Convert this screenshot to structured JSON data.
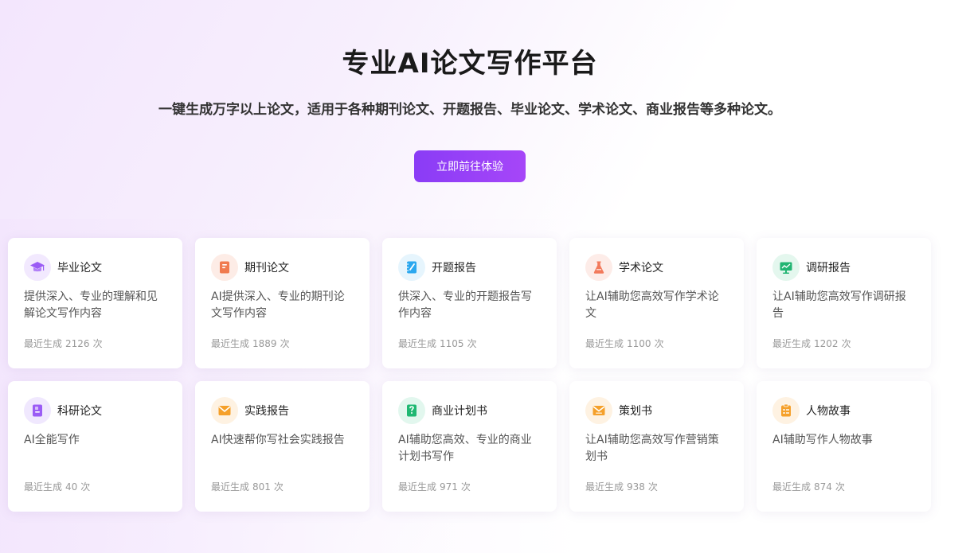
{
  "hero": {
    "title": "专业AI论文写作平台",
    "subtitle": "一键生成万字以上论文，适用于各种期刊论文、开题报告、毕业论文、学术论文、商业报告等多种论文。",
    "cta_label": "立即前往体验"
  },
  "stats_prefix": "最近生成",
  "stats_suffix": "次",
  "colors": {
    "accent": "#9340f7"
  },
  "cards": [
    {
      "title": "毕业论文",
      "desc": "提供深入、专业的理解和见解论文写作内容",
      "count": "2126",
      "icon": "graduation-cap-icon",
      "icon_bg": "#f2e9fe",
      "icon_color": "#9b5cf5"
    },
    {
      "title": "期刊论文",
      "desc": "AI提供深入、专业的期刊论文写作内容",
      "count": "1889",
      "icon": "journal-icon",
      "icon_bg": "#fdece6",
      "icon_color": "#f07b4f"
    },
    {
      "title": "开题报告",
      "desc": "供深入、专业的开题报告写作内容",
      "count": "1105",
      "icon": "notebook-icon",
      "icon_bg": "#e6f5fd",
      "icon_color": "#2ba8ef"
    },
    {
      "title": "学术论文",
      "desc": "让AI辅助您高效写作学术论文",
      "count": "1100",
      "icon": "flask-icon",
      "icon_bg": "#fdece8",
      "icon_color": "#f27a5c"
    },
    {
      "title": "调研报告",
      "desc": "让AI辅助您高效写作调研报告",
      "count": "1202",
      "icon": "monitor-chart-icon",
      "icon_bg": "#e4f7ee",
      "icon_color": "#22b573"
    },
    {
      "title": "科研论文",
      "desc": "AI全能写作",
      "count": "40",
      "icon": "book-icon",
      "icon_bg": "#f0e8fe",
      "icon_color": "#9b5cf5"
    },
    {
      "title": "实践报告",
      "desc": "AI快速帮你写社会实践报告",
      "count": "801",
      "icon": "envelope-icon",
      "icon_bg": "#fef2e2",
      "icon_color": "#f5a02a"
    },
    {
      "title": "商业计划书",
      "desc": "AI辅助您高效、专业的商业计划书写作",
      "count": "971",
      "icon": "document-chart-icon",
      "icon_bg": "#e2f7ee",
      "icon_color": "#1fb872"
    },
    {
      "title": "策划书",
      "desc": "让AI辅助您高效写作营销策划书",
      "count": "938",
      "icon": "mail-icon",
      "icon_bg": "#fef2e2",
      "icon_color": "#f5a02a"
    },
    {
      "title": "人物故事",
      "desc": "AI辅助写作人物故事",
      "count": "874",
      "icon": "clipboard-icon",
      "icon_bg": "#fef2e2",
      "icon_color": "#f5a02a"
    }
  ]
}
